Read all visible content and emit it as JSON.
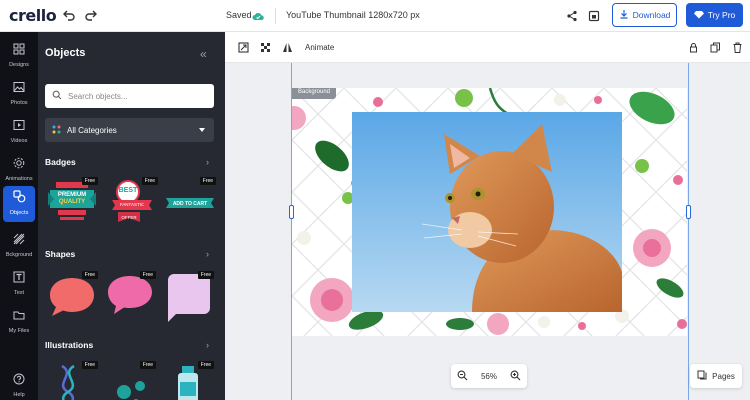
{
  "app": {
    "logo": "crello"
  },
  "header": {
    "saved_label": "Saved",
    "document_title": "YouTube Thumbnail 1280x720 px",
    "download_label": "Download",
    "try_pro_label": "Try Pro"
  },
  "rail": {
    "items": [
      {
        "label": "Designs",
        "icon": "designs-icon"
      },
      {
        "label": "Photos",
        "icon": "photos-icon"
      },
      {
        "label": "Videos",
        "icon": "videos-icon"
      },
      {
        "label": "Animations",
        "icon": "animations-icon"
      },
      {
        "label": "Objects",
        "icon": "objects-icon",
        "active": true
      },
      {
        "label": "Bckground",
        "icon": "background-icon"
      },
      {
        "label": "Text",
        "icon": "text-icon"
      },
      {
        "label": "My Files",
        "icon": "folder-icon"
      },
      {
        "label": "Help",
        "icon": "help-icon"
      }
    ]
  },
  "panel": {
    "title": "Objects",
    "search_placeholder": "Search objects...",
    "category": "All Categories",
    "sections": [
      {
        "title": "Badges"
      },
      {
        "title": "Shapes"
      },
      {
        "title": "Illustrations"
      }
    ],
    "free_label": "Free",
    "badges": {
      "premium_line1": "PREMIUM",
      "premium_line2": "QUALITY",
      "best_line1": "BEST",
      "best_line2": "FANTASTIC",
      "best_line3": "OFFER",
      "cart": "ADD TO CART"
    },
    "shape_colors": [
      "#f26b6b",
      "#ef6aa8",
      "#e8c6ee"
    ]
  },
  "canvas_toolbar": {
    "animate_label": "Animate"
  },
  "canvas": {
    "background_tag": "Background",
    "zoom_value": "56%",
    "pages_label": "Pages"
  },
  "colors": {
    "accent": "#1f5bd8",
    "rail_bg": "#0f1117",
    "panel_bg": "#262932",
    "saved_cloud": "#2bb39a"
  }
}
